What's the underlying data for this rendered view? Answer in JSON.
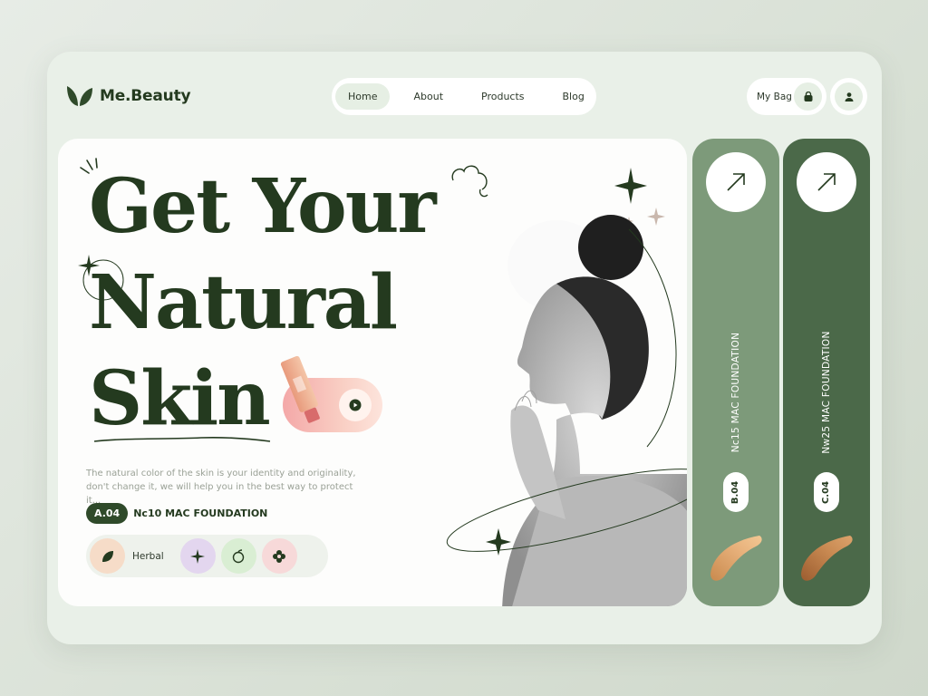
{
  "brand": {
    "name": "Me.Beauty"
  },
  "nav": {
    "items": [
      "Home",
      "About",
      "Products",
      "Blog"
    ],
    "active": "Home"
  },
  "header": {
    "bag_label": "My Bag"
  },
  "hero": {
    "headline": [
      "Get Your",
      "Natural",
      "Skin"
    ],
    "description": "The natural color of the skin is your identity and originality, don't change it, we will help you in the best way to protect it...",
    "product_code": "A.04",
    "product_name": "Nc10 MAC FOUNDATION",
    "tags": [
      {
        "label": "Herbal",
        "icon": "leaf-icon"
      },
      {
        "label": "",
        "icon": "sparkle-icon"
      },
      {
        "label": "",
        "icon": "fruit-icon"
      },
      {
        "label": "",
        "icon": "flower-icon"
      }
    ]
  },
  "products": [
    {
      "code": "B.04",
      "name": "Nc15 MAC FOUNDATION",
      "color": "#7d9a7a"
    },
    {
      "code": "C.04",
      "name": "Nw25 MAC FOUNDATION",
      "color": "#4b6949"
    }
  ],
  "colors": {
    "primary": "#243a1f",
    "accent_green": "#4b6949",
    "light_green": "#e9f0e8"
  }
}
